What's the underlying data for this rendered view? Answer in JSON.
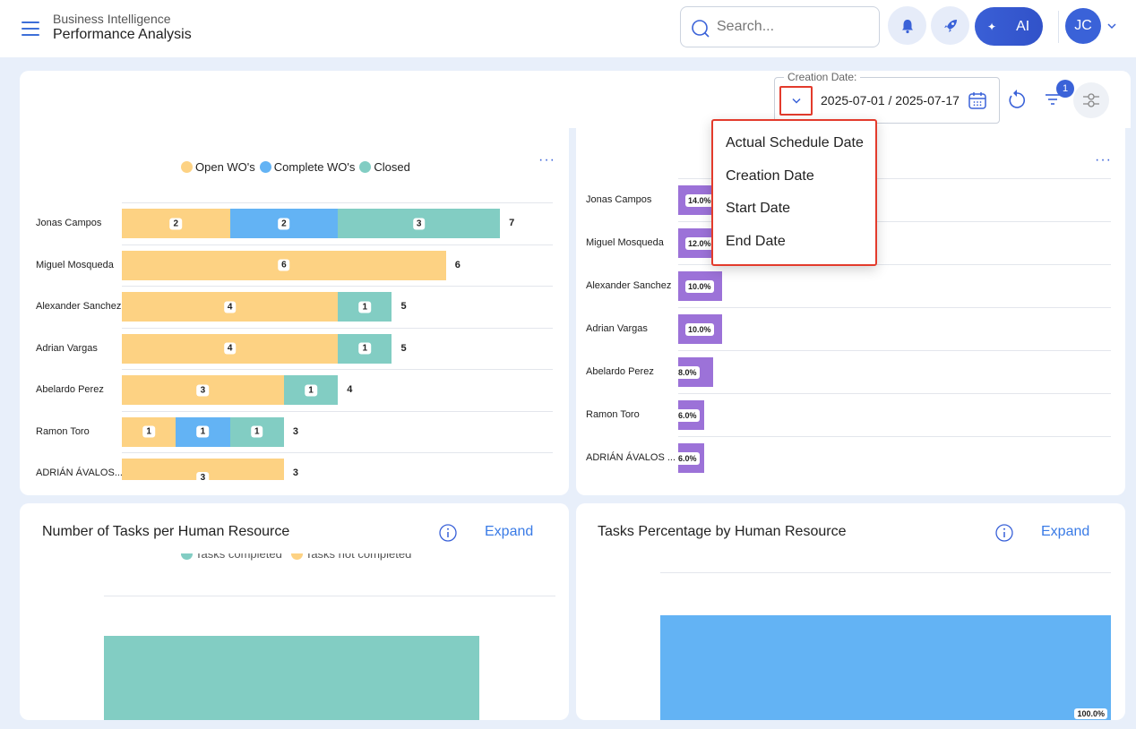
{
  "header": {
    "subtitle": "Business Intelligence",
    "title": "Performance Analysis",
    "search_placeholder": "Search...",
    "ai_label": "AI",
    "avatar_initials": "JC"
  },
  "filters": {
    "date_label": "Creation Date:",
    "date_range": "2025-07-01 / 2025-07-17",
    "filter_count": "1",
    "date_type_options": [
      "Actual Schedule Date",
      "Creation Date",
      "Start Date",
      "End Date"
    ]
  },
  "colors": {
    "open": "#fdd283",
    "complete": "#63b3f4",
    "closed": "#82cdc3",
    "percentage": "#9c72d8",
    "accent": "#3a62d8"
  },
  "chart_data": [
    {
      "type": "bar",
      "orientation": "horizontal",
      "stacked": true,
      "legend": [
        "Open WO's",
        "Complete WO's",
        "Closed"
      ],
      "categories": [
        "Jonas Campos",
        "Miguel Mosqueda",
        "Alexander Sanchez",
        "Adrian Vargas",
        "Abelardo Perez",
        "Ramon Toro",
        "ADRIÁN ÁVALOS..."
      ],
      "series": [
        {
          "name": "Open WO's",
          "values": [
            2,
            6,
            4,
            4,
            3,
            1,
            3
          ]
        },
        {
          "name": "Complete WO's",
          "values": [
            2,
            0,
            0,
            0,
            0,
            1,
            0
          ]
        },
        {
          "name": "Closed",
          "values": [
            3,
            0,
            1,
            1,
            1,
            1,
            0
          ]
        }
      ],
      "totals": [
        7,
        6,
        5,
        5,
        4,
        3,
        3
      ]
    },
    {
      "type": "bar",
      "orientation": "horizontal",
      "categories": [
        "Jonas Campos",
        "Miguel Mosqueda",
        "Alexander Sanchez",
        "Adrian Vargas",
        "Abelardo Perez",
        "Ramon Toro",
        "ADRIÁN ÁVALOS ..."
      ],
      "values": [
        14.0,
        12.0,
        10.0,
        10.0,
        8.0,
        6.0,
        6.0
      ],
      "value_labels": [
        "14.0%",
        "12.0%",
        "10.0%",
        "10.0%",
        "8.0%",
        "6.0%",
        "6.0%"
      ]
    },
    {
      "type": "bar",
      "title": "Number of Tasks per Human Resource",
      "legend": [
        "Tasks completed",
        "Tasks not completed"
      ]
    },
    {
      "type": "bar",
      "title": "Tasks Percentage by Human Resource",
      "value_labels": [
        "100.0%"
      ]
    }
  ],
  "cards": {
    "expand_label": "Expand",
    "more_label": "···"
  }
}
